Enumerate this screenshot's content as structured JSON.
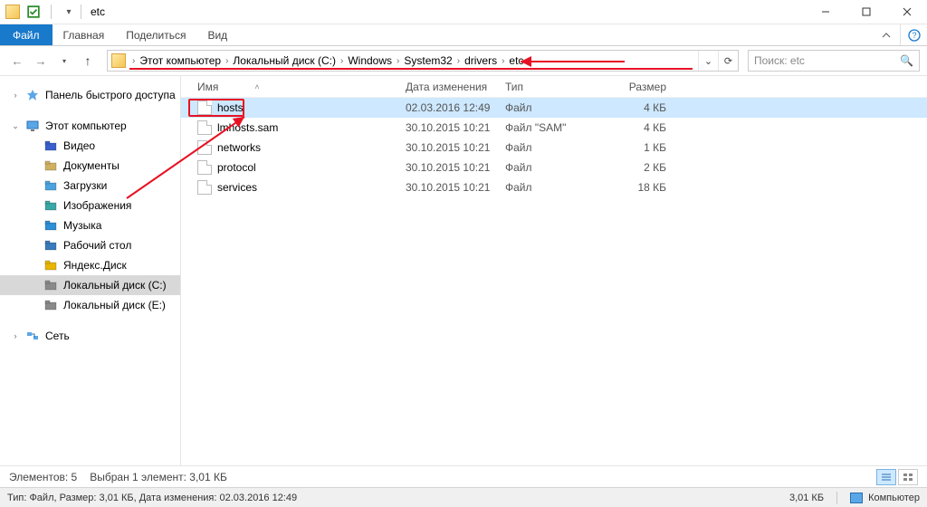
{
  "window": {
    "title": "etc"
  },
  "ribbon": {
    "file": "Файл",
    "tabs": [
      "Главная",
      "Поделиться",
      "Вид"
    ]
  },
  "breadcrumb": [
    "Этот компьютер",
    "Локальный диск (C:)",
    "Windows",
    "System32",
    "drivers",
    "etc"
  ],
  "search": {
    "placeholder": "Поиск: etc"
  },
  "sidebar": {
    "quick_access": "Панель быстрого доступа",
    "this_pc": "Этот компьютер",
    "this_pc_children": [
      {
        "label": "Видео",
        "color": "#3a5fcd"
      },
      {
        "label": "Документы",
        "color": "#d0b060"
      },
      {
        "label": "Загрузки",
        "color": "#4aa3df"
      },
      {
        "label": "Изображения",
        "color": "#3aa6a6"
      },
      {
        "label": "Музыка",
        "color": "#2d8fd6"
      },
      {
        "label": "Рабочий стол",
        "color": "#3a7abd"
      },
      {
        "label": "Яндекс.Диск",
        "color": "#e8b500"
      },
      {
        "label": "Локальный диск (C:)",
        "color": "#8a8a8a",
        "selected": true
      },
      {
        "label": "Локальный диск (E:)",
        "color": "#8a8a8a"
      }
    ],
    "network": "Сеть"
  },
  "columns": {
    "name": "Имя",
    "date": "Дата изменения",
    "type": "Тип",
    "size": "Размер"
  },
  "files": [
    {
      "name": "hosts",
      "date": "02.03.2016 12:49",
      "type": "Файл",
      "size": "4 КБ",
      "selected": true
    },
    {
      "name": "lmhosts.sam",
      "date": "30.10.2015 10:21",
      "type": "Файл \"SAM\"",
      "size": "4 КБ"
    },
    {
      "name": "networks",
      "date": "30.10.2015 10:21",
      "type": "Файл",
      "size": "1 КБ"
    },
    {
      "name": "protocol",
      "date": "30.10.2015 10:21",
      "type": "Файл",
      "size": "2 КБ"
    },
    {
      "name": "services",
      "date": "30.10.2015 10:21",
      "type": "Файл",
      "size": "18 КБ"
    }
  ],
  "status": {
    "elements": "Элементов: 5",
    "selected": "Выбран 1 элемент: 3,01 КБ"
  },
  "footer": {
    "left": "Тип: Файл, Размер: 3,01 КБ, Дата изменения: 02.03.2016 12:49",
    "size": "3,01 КБ",
    "location": "Компьютер"
  }
}
